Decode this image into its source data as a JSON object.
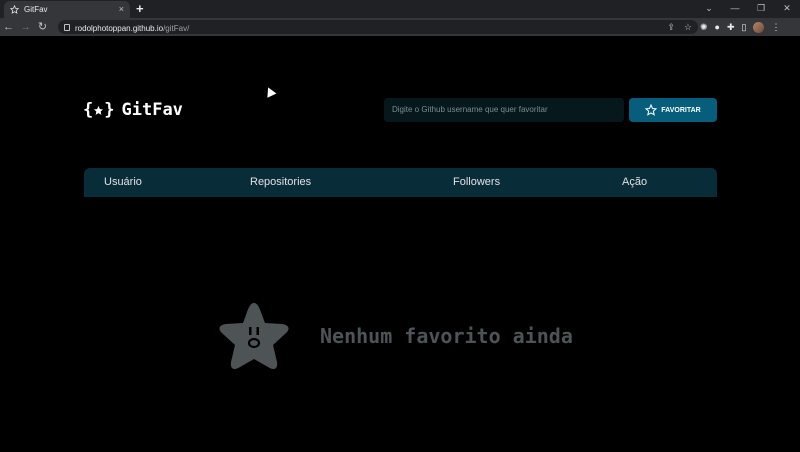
{
  "browser": {
    "tab_title": "GitFav",
    "tab_close": "×",
    "new_tab": "+",
    "url_host": "rodolphotoppan.github.io",
    "url_path": "/gitFav/",
    "window_controls": [
      "⌄",
      "—",
      "❐",
      "✕"
    ]
  },
  "header": {
    "logo_text": "GitFav",
    "search_placeholder": "Digite o Github username que quer favoritar",
    "favorite_button_label": "FAVORITAR"
  },
  "table": {
    "headers": [
      "Usuário",
      "Repositories",
      "Followers",
      "Ação"
    ]
  },
  "empty_state": {
    "message": "Nenhum favorito ainda",
    "icon": "sad-star-icon"
  },
  "colors": {
    "background": "#000000",
    "accent": "#065e7c",
    "table_header": "#092d38",
    "muted": "#4e5455"
  }
}
